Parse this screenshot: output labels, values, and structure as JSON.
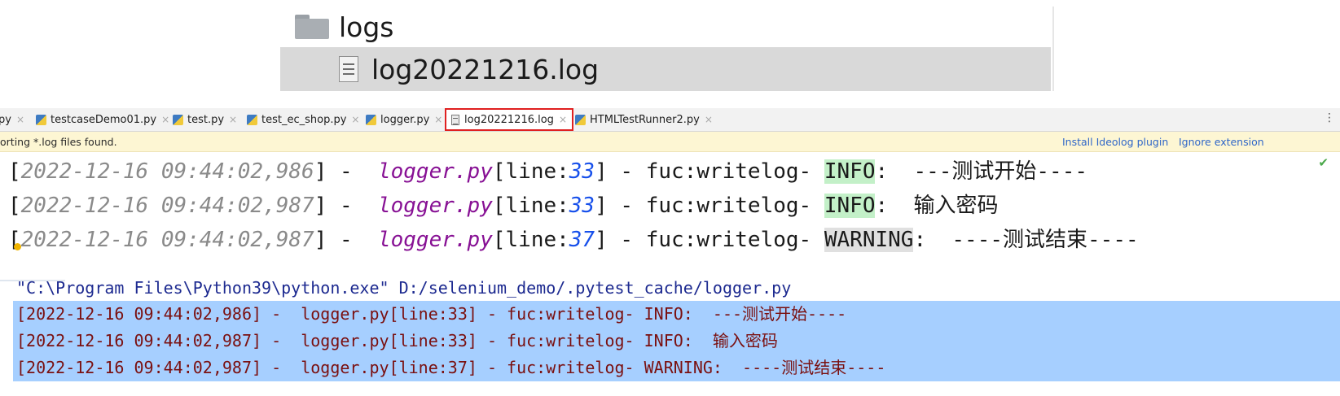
{
  "explorer": {
    "folder_name": "logs",
    "file_name": "log20221216.log",
    "folder_icon": "folder-icon",
    "file_icon": "text-file-icon"
  },
  "tabs": [
    {
      "label": "py",
      "icon": "python-file-icon"
    },
    {
      "label": "testcaseDemo01.py",
      "icon": "python-file-icon"
    },
    {
      "label": "test.py",
      "icon": "python-file-icon"
    },
    {
      "label": "test_ec_shop.py",
      "icon": "python-file-icon"
    },
    {
      "label": "logger.py",
      "icon": "python-file-icon"
    },
    {
      "label": "log20221216.log",
      "icon": "text-file-icon"
    },
    {
      "label": "HTMLTestRunner2.py",
      "icon": "python-file-icon"
    }
  ],
  "tab_close_glyph": "×",
  "tab_more_glyph": "⋮",
  "active_tab_highlight": "#e02020",
  "banner": {
    "message": "orting *.log files found.",
    "install_link": "Install Ideolog plugin",
    "ignore_link": "Ignore extension"
  },
  "editor": {
    "lines": [
      {
        "bracket_open": "[",
        "timestamp": "2022-12-16 09:44:02,986",
        "mid1": "] -  ",
        "module": "logger.py",
        "line_pre": "[line:",
        "line_no": "33",
        "mid2": "] - fuc:writelog- ",
        "level": "INFO",
        "message": ":  ---测试开始----"
      },
      {
        "bracket_open": "[",
        "timestamp": "2022-12-16 09:44:02,987",
        "mid1": "] -  ",
        "module": "logger.py",
        "line_pre": "[line:",
        "line_no": "33",
        "mid2": "] - fuc:writelog- ",
        "level": "INFO",
        "message": ":  输入密码"
      },
      {
        "bracket_open": "[",
        "timestamp": "2022-12-16 09:44:02,987",
        "mid1": "] -  ",
        "module": "logger.py",
        "line_pre": "[line:",
        "line_no": "37",
        "mid2": "] - fuc:writelog- ",
        "level": "WARNING",
        "message": ":  ----测试结束----"
      }
    ],
    "check_glyph": "✔"
  },
  "console": {
    "command": "\"C:\\Program Files\\Python39\\python.exe\" D:/selenium_demo/.pytest_cache/logger.py",
    "output": [
      "[2022-12-16 09:44:02,986] -  logger.py[line:33] - fuc:writelog- INFO:  ---测试开始----",
      "[2022-12-16 09:44:02,987] -  logger.py[line:33] - fuc:writelog- INFO:  输入密码",
      "[2022-12-16 09:44:02,987] -  logger.py[line:37] - fuc:writelog- WARNING:  ----测试结束----"
    ]
  },
  "colors": {
    "info_highlight": "#c3f0c8",
    "warning_highlight": "#e0e0e0",
    "selection": "#a6cfff",
    "output_text": "#7a1010"
  }
}
